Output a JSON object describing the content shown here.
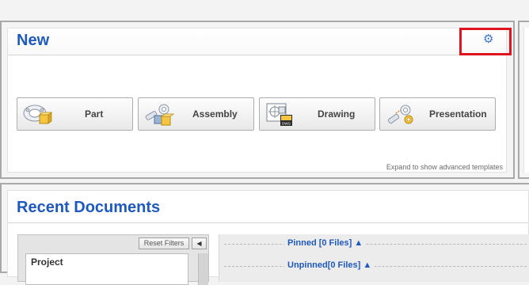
{
  "new_section": {
    "title": "New",
    "settings_icon": "gear-icon",
    "templates": [
      {
        "label": "Part",
        "icon": "part-icon"
      },
      {
        "label": "Assembly",
        "icon": "assembly-icon"
      },
      {
        "label": "Drawing",
        "icon": "drawing-icon"
      },
      {
        "label": "Presentation",
        "icon": "presentation-icon"
      }
    ],
    "expand_text": "Expand to show advanced templates"
  },
  "recent_section": {
    "title": "Recent Documents",
    "reset_filters_label": "Reset Filters",
    "collapse_glyph": "◀",
    "project_label": "Project",
    "pinned_label": "Pinned [0 Files] ▲",
    "unpinned_label": "Unpinned[0 Files] ▲"
  },
  "colors": {
    "title_blue": "#1e59bd",
    "highlight_red": "#e0141f",
    "gear_blue": "#3f74c9"
  }
}
